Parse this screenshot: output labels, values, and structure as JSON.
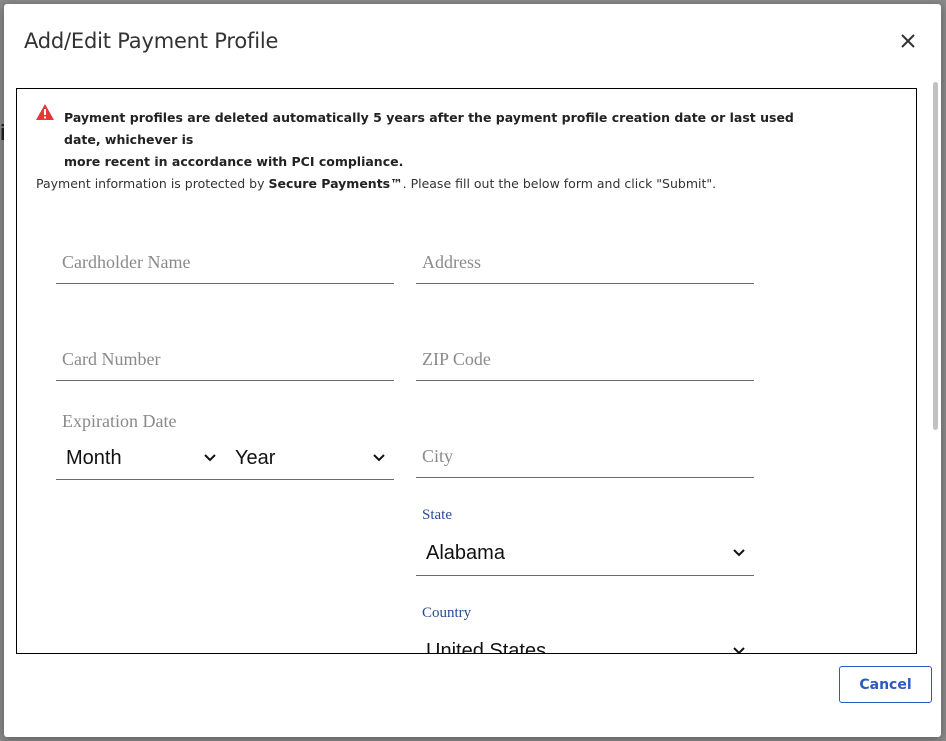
{
  "dialog": {
    "title": "Add/Edit Payment Profile",
    "close_icon": "close-icon"
  },
  "warning": {
    "icon": "warning-triangle-icon",
    "color": "#e53935",
    "line1": "Payment profiles are deleted automatically 5 years after the payment profile creation date or last used date, whichever is",
    "line2": "more recent in accordance with PCI compliance."
  },
  "info": {
    "prefix": "Payment information is protected by ",
    "brand": "Secure Payments™",
    "suffix": ". Please fill out the below form and click \"Submit\"."
  },
  "form": {
    "cardholder_name": {
      "placeholder": "Cardholder Name",
      "value": ""
    },
    "address": {
      "placeholder": "Address",
      "value": ""
    },
    "card_number": {
      "placeholder": "Card Number",
      "value": ""
    },
    "zip": {
      "placeholder": "ZIP Code",
      "value": ""
    },
    "expiration": {
      "label": "Expiration Date",
      "month": "Month",
      "year": "Year"
    },
    "city": {
      "placeholder": "City",
      "value": ""
    },
    "state": {
      "label": "State",
      "value": "Alabama"
    },
    "country": {
      "label": "Country",
      "value": "United States"
    }
  },
  "footer": {
    "cancel_label": "Cancel",
    "accent": "#2a5bbf"
  }
}
